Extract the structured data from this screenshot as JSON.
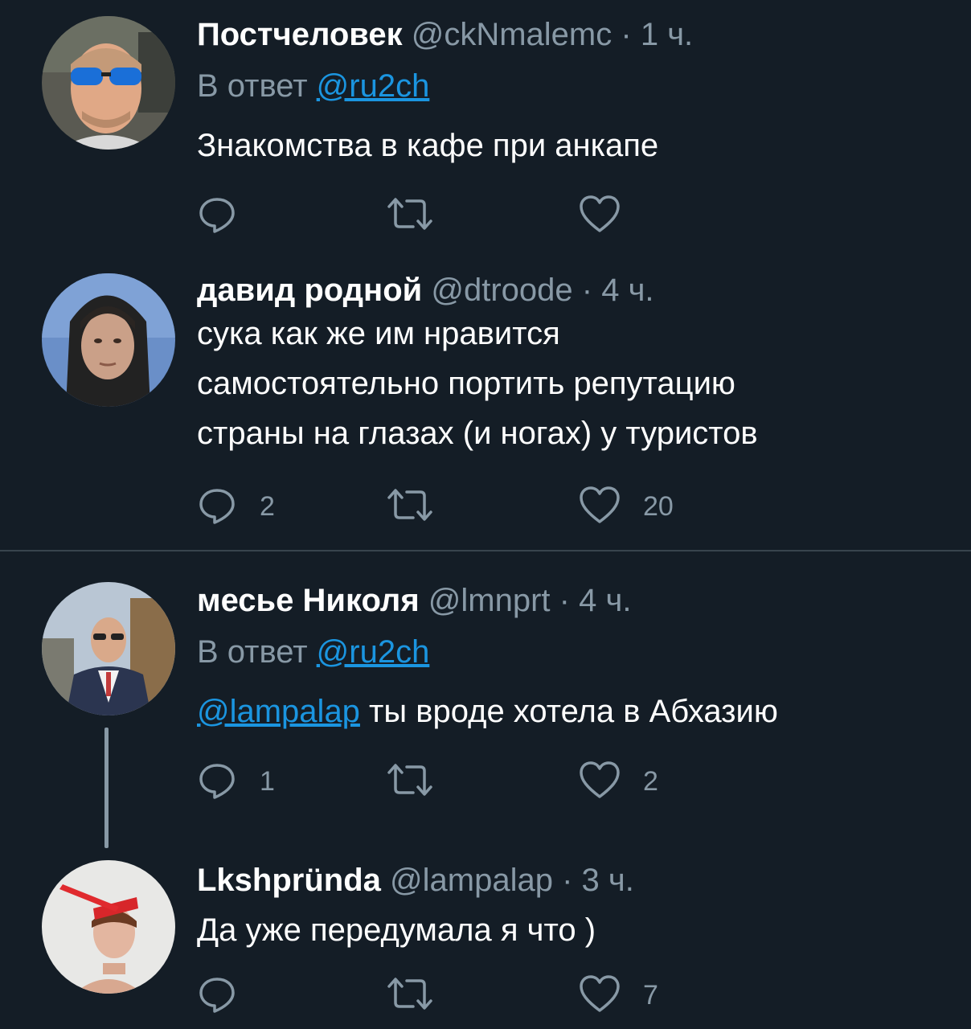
{
  "tweets": [
    {
      "name": "Постчеловек",
      "handle": "@ckNmalemc",
      "dot": "·",
      "time": "1 ч.",
      "reply_prefix": "В ответ",
      "reply_to": "@ru2ch",
      "text": "Знакомства в кафе при анкапе",
      "mention": "",
      "replies": "",
      "retweets": "",
      "likes": ""
    },
    {
      "name": "давид родной",
      "handle": "@dtroode",
      "dot": "·",
      "time": "4 ч.",
      "text_lines": [
        "сука как же им нравится",
        "самостоятельно портить репутацию",
        "страны на глазах (и ногах) у туристов"
      ],
      "replies": "2",
      "retweets": "",
      "likes": "20"
    },
    {
      "name": "месье Николя",
      "handle": "@lmnprt",
      "dot": "·",
      "time": "4 ч.",
      "reply_prefix": "В ответ",
      "reply_to": "@ru2ch",
      "mention": "@lampalap",
      "text": " ты вроде хотела в Абхазию",
      "replies": "1",
      "retweets": "",
      "likes": "2"
    },
    {
      "name": "Lkshpründa",
      "handle": "@lampalap",
      "dot": "·",
      "time": "3 ч.",
      "text": "Да уже передумала я что )",
      "replies": "",
      "retweets": "",
      "likes": "7"
    }
  ],
  "icons": {
    "reply": "reply-icon",
    "retweet": "retweet-icon",
    "like": "heart-icon"
  },
  "colors": {
    "background": "#141d26",
    "secondary_text": "#8899a6",
    "link": "#1b95e0",
    "divider": "#38444d"
  }
}
